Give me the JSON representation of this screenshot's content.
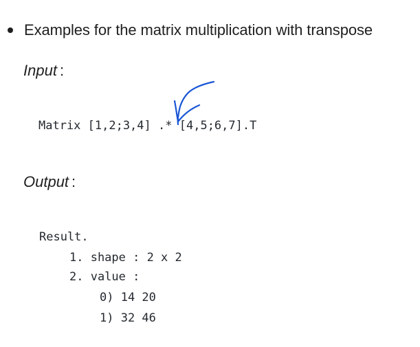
{
  "bullet": {
    "text": "Examples for the matrix multiplication with transpose"
  },
  "input_section": {
    "label": "Input",
    "colon": ":",
    "code": {
      "prefix": "Matrix [1,2;3,4]",
      "operator": ".*",
      "suffix": "[4,5;6,7].T"
    }
  },
  "output_section": {
    "label": "Output",
    "colon": ":",
    "result_title": "Result.",
    "shape_line": "1. shape : 2 x 2",
    "value_line": "2. value :",
    "rows": [
      "0) 14 20",
      "1) 32 46"
    ]
  },
  "annotation": {
    "color": "#1a56d6",
    "icon": "handwritten-arrow-icon"
  }
}
